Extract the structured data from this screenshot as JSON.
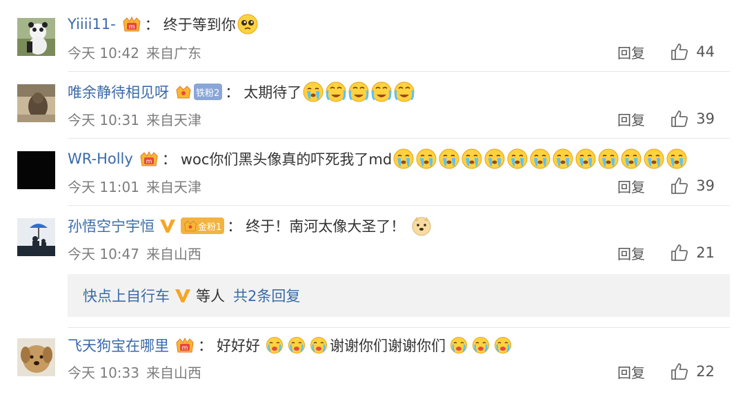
{
  "comments": [
    {
      "username": "Yiiii11-",
      "text": "终于等到你",
      "time": "今天 10:42",
      "location": "来自广东",
      "reply_label": "回复",
      "likes": "44",
      "avatar": "panda-avatar"
    },
    {
      "username": "唯余静待相见呀",
      "fan_badge": "铁粉2",
      "text": "太期待了",
      "time": "今天 10:31",
      "location": "来自天津",
      "reply_label": "回复",
      "likes": "39",
      "avatar": "dog-photo-avatar"
    },
    {
      "username": "WR-Holly",
      "text": "woc你们黑头像真的吓死我了md",
      "time": "今天 11:01",
      "location": "来自天津",
      "reply_label": "回复",
      "likes": "39",
      "avatar": "black-avatar"
    },
    {
      "username": "孙悟空宁宇恒",
      "fan_badge": "金粉1",
      "text": "终于！南河太像大圣了！",
      "time": "今天 10:47",
      "location": "来自山西",
      "reply_label": "回复",
      "likes": "21",
      "avatar": "umbrella-avatar"
    },
    {
      "username": "飞天狗宝在哪里",
      "text_a": "好好好",
      "text_b": "谢谢你们谢谢你们",
      "time": "今天 10:33",
      "location": "来自山西",
      "reply_label": "回复",
      "likes": "22",
      "avatar": "puppy-avatar"
    }
  ],
  "sub_reply": {
    "username": "快点上自行车",
    "text": "等人",
    "count_label": "共2条回复"
  },
  "colors": {
    "username": "#3a6aa8",
    "meta": "#7d7d7d",
    "reply_box_bg": "#f2f2f2",
    "iron_badge": "#8aa6d8",
    "gold_badge": "#f3b33e",
    "verified_v": "#f5a623"
  }
}
